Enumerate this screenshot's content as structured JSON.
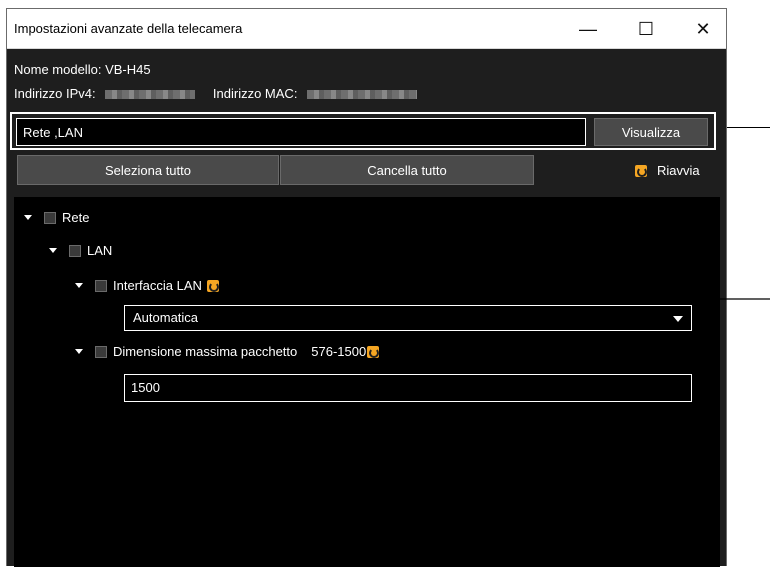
{
  "window": {
    "title": "Impostazioni avanzate della telecamera",
    "minimize": "—",
    "maximize": "☐",
    "close": "✕"
  },
  "info": {
    "model_label": "Nome modello:",
    "model_value": "VB-H45",
    "ipv4_label": "Indirizzo IPv4:",
    "mac_label": "Indirizzo MAC:"
  },
  "search": {
    "value": "Rete ,LAN",
    "button": "Visualizza"
  },
  "toolbar": {
    "select_all": "Seleziona tutto",
    "clear_all": "Cancella tutto",
    "restart": "Riavvia"
  },
  "tree": {
    "rete": "Rete",
    "lan": "LAN",
    "interface": {
      "label": "Interfaccia LAN",
      "value": "Automatica"
    },
    "packet": {
      "label": "Dimensione massima pacchetto",
      "range": "576-1500",
      "value": "1500"
    }
  },
  "colors": {
    "accent": "#f5a623",
    "background": "#1e1e1e",
    "tree_bg": "#000000"
  },
  "icons": [
    "restart-icon",
    "expand-arrow-icon",
    "dropdown-caret-icon"
  ]
}
